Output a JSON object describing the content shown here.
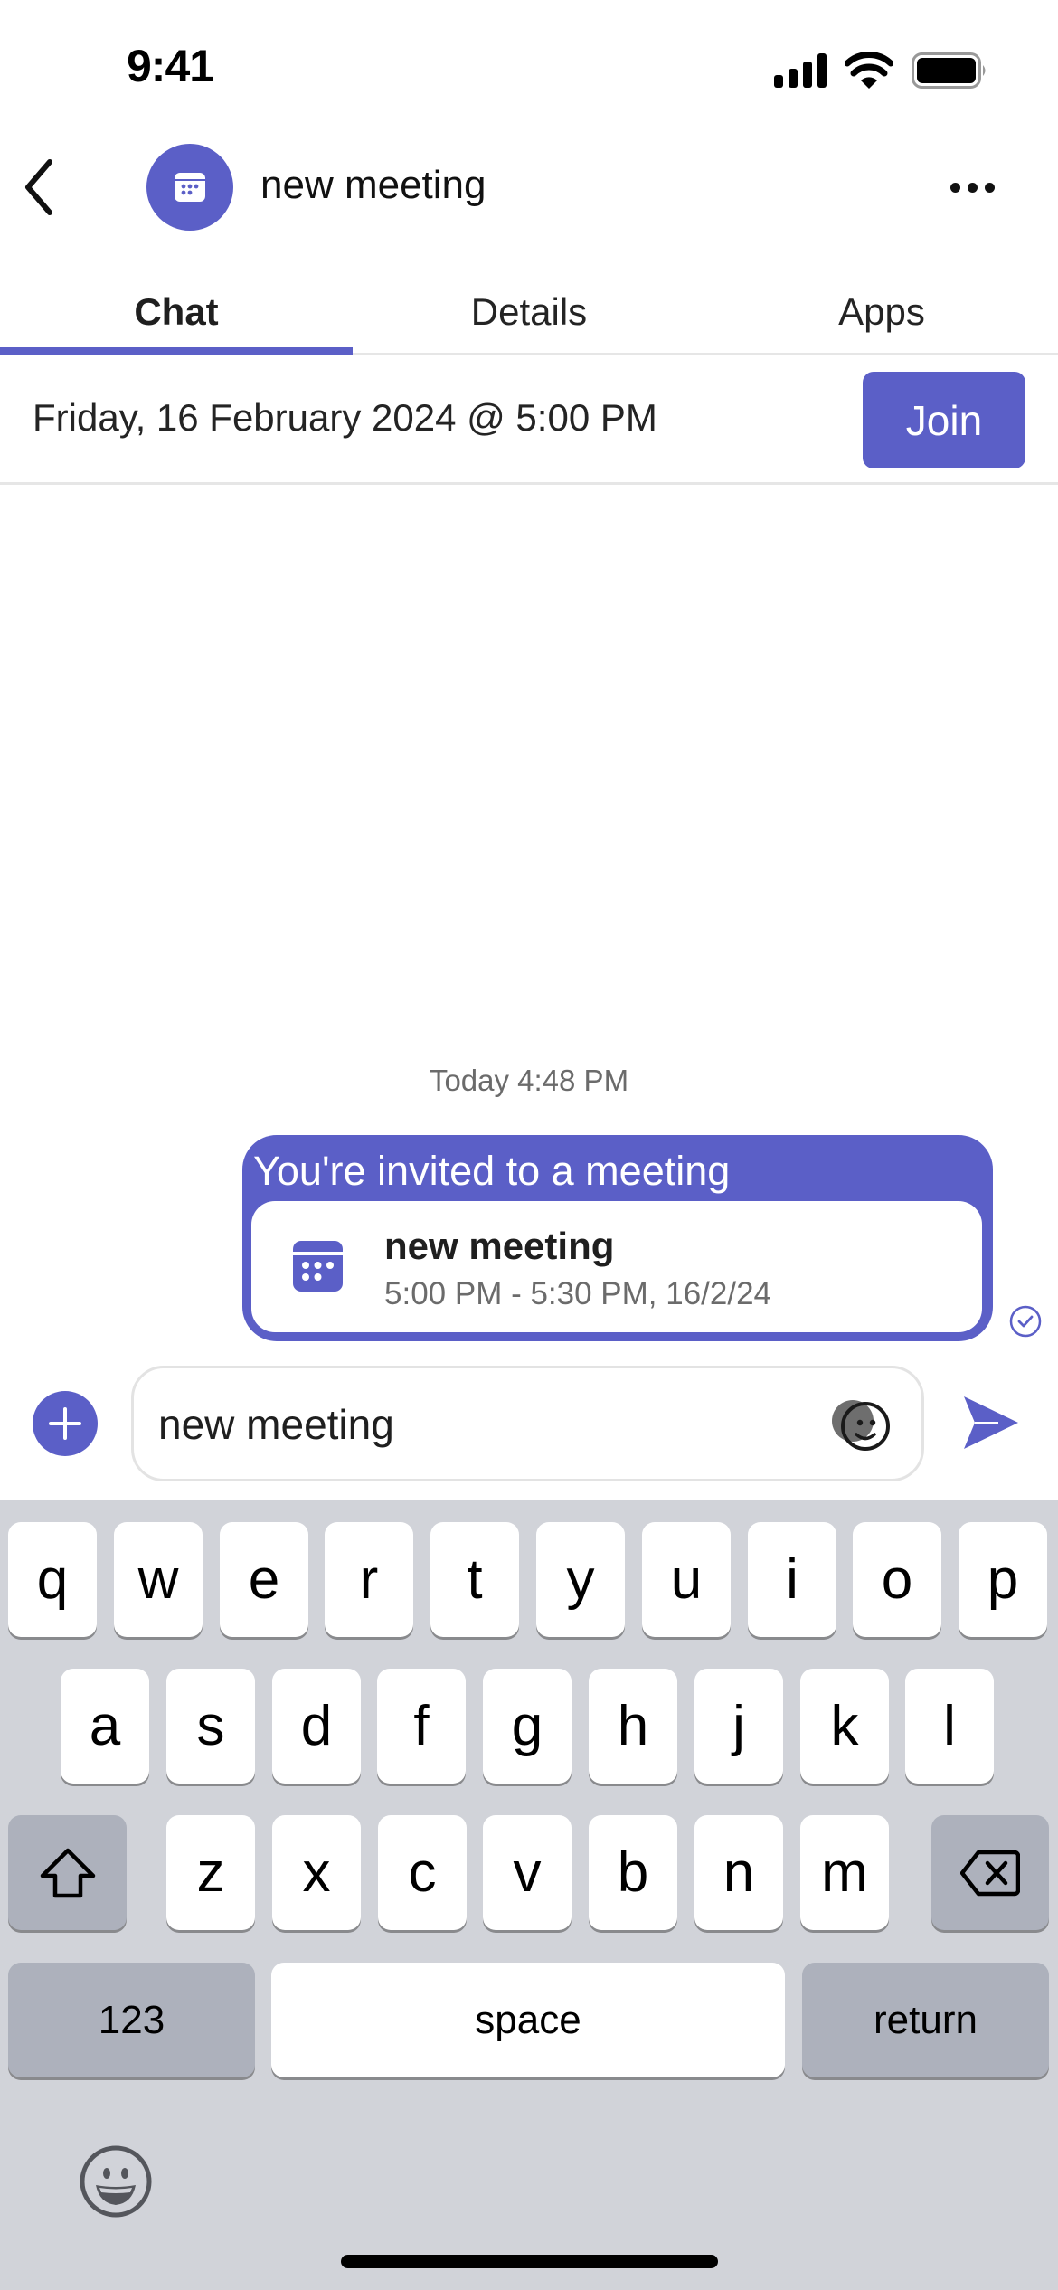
{
  "status_bar": {
    "time": "9:41",
    "icons": [
      "cellular-signal-icon",
      "wifi-icon",
      "battery-icon"
    ]
  },
  "header": {
    "title": "new meeting",
    "avatar_icon": "calendar-icon",
    "back_icon": "chevron-left-icon",
    "more_icon": "more-horizontal-icon"
  },
  "tabs": [
    {
      "label": "Chat",
      "active": true
    },
    {
      "label": "Details",
      "active": false
    },
    {
      "label": "Apps",
      "active": false
    }
  ],
  "meeting_bar": {
    "date_text": "Friday, 16 February 2024 @ 5:00 PM",
    "join_label": "Join"
  },
  "messages": {
    "timestamp": "Today 4:48 PM",
    "bubble": {
      "title": "You're invited to a meeting",
      "card_title": "new meeting",
      "card_subtitle": "5:00 PM - 5:30 PM, 16/2/24",
      "card_icon": "calendar-icon",
      "status_icon": "read-receipt-check-icon"
    }
  },
  "compose": {
    "value": "new meeting",
    "placeholder": "",
    "plus_icon": "plus-icon",
    "emoji_icon": "emoji-picker-icon",
    "send_icon": "send-icon"
  },
  "keyboard": {
    "row1": [
      "q",
      "w",
      "e",
      "r",
      "t",
      "y",
      "u",
      "i",
      "o",
      "p"
    ],
    "row2": [
      "a",
      "s",
      "d",
      "f",
      "g",
      "h",
      "j",
      "k",
      "l"
    ],
    "row3": [
      "z",
      "x",
      "c",
      "v",
      "b",
      "n",
      "m"
    ],
    "numbers_label": "123",
    "space_label": "space",
    "return_label": "return",
    "shift_icon": "shift-icon",
    "delete_icon": "backspace-icon",
    "emoji_icon": "emoji-keyboard-icon"
  },
  "colors": {
    "accent": "#5b5fc7",
    "keyboard_bg": "#d1d3d9",
    "key_dark": "#adb1bc",
    "muted_text": "#6b6b6b"
  }
}
